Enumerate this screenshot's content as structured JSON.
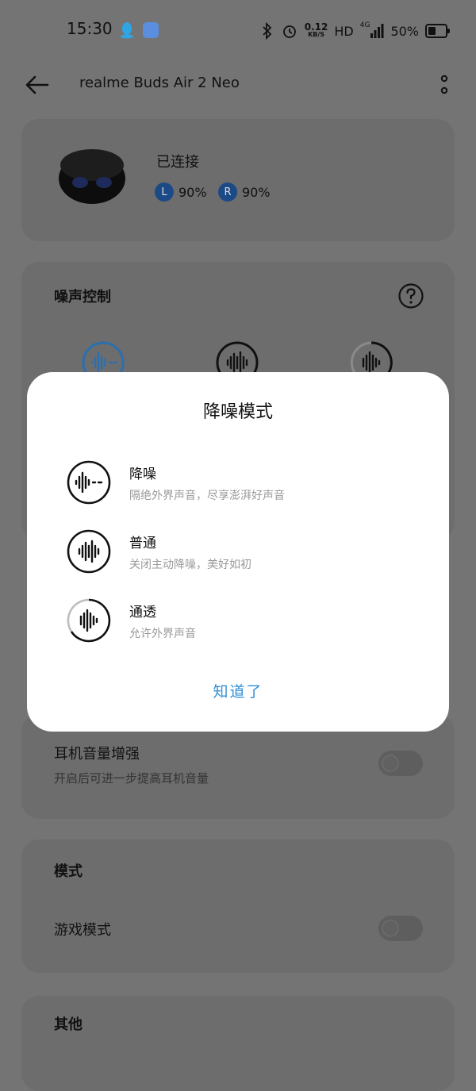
{
  "status_bar": {
    "time": "15:30",
    "net_speed_value": "0.12",
    "net_speed_unit": "KB/S",
    "hd": "HD",
    "network": "4G",
    "battery_percent": "50%",
    "battery_level": 0.5,
    "icons": [
      "qq-icon",
      "cloud-app-icon",
      "bluetooth-icon",
      "alarm-icon",
      "signal-icon",
      "battery-icon"
    ]
  },
  "app_bar": {
    "title": "realme Buds Air 2 Neo",
    "icons": [
      "back-arrow-icon",
      "more-vertical-icon"
    ]
  },
  "device": {
    "status": "已连接",
    "left_label": "L",
    "left_battery": "90%",
    "right_label": "R",
    "right_battery": "90%"
  },
  "noise_control": {
    "title": "噪声控制"
  },
  "volume_boost": {
    "title": "耳机音量增强",
    "description": "开启后可进一步提高耳机音量",
    "enabled": false
  },
  "mode": {
    "title": "模式",
    "game_mode_label": "游戏模式",
    "game_mode_enabled": false
  },
  "other": {
    "title": "其他"
  },
  "dialog": {
    "title": "降噪模式",
    "options": [
      {
        "name": "降噪",
        "description": "隔绝外界声音，尽享澎湃好声音"
      },
      {
        "name": "普通",
        "description": "关闭主动降噪，美好如初"
      },
      {
        "name": "通透",
        "description": "允许外界声音"
      }
    ],
    "confirm": "知道了"
  },
  "colors": {
    "accent": "#2f8fd6",
    "overlay_background": "#747474",
    "dialog_background": "#ffffff",
    "battery_badge": "#1c4a86"
  }
}
